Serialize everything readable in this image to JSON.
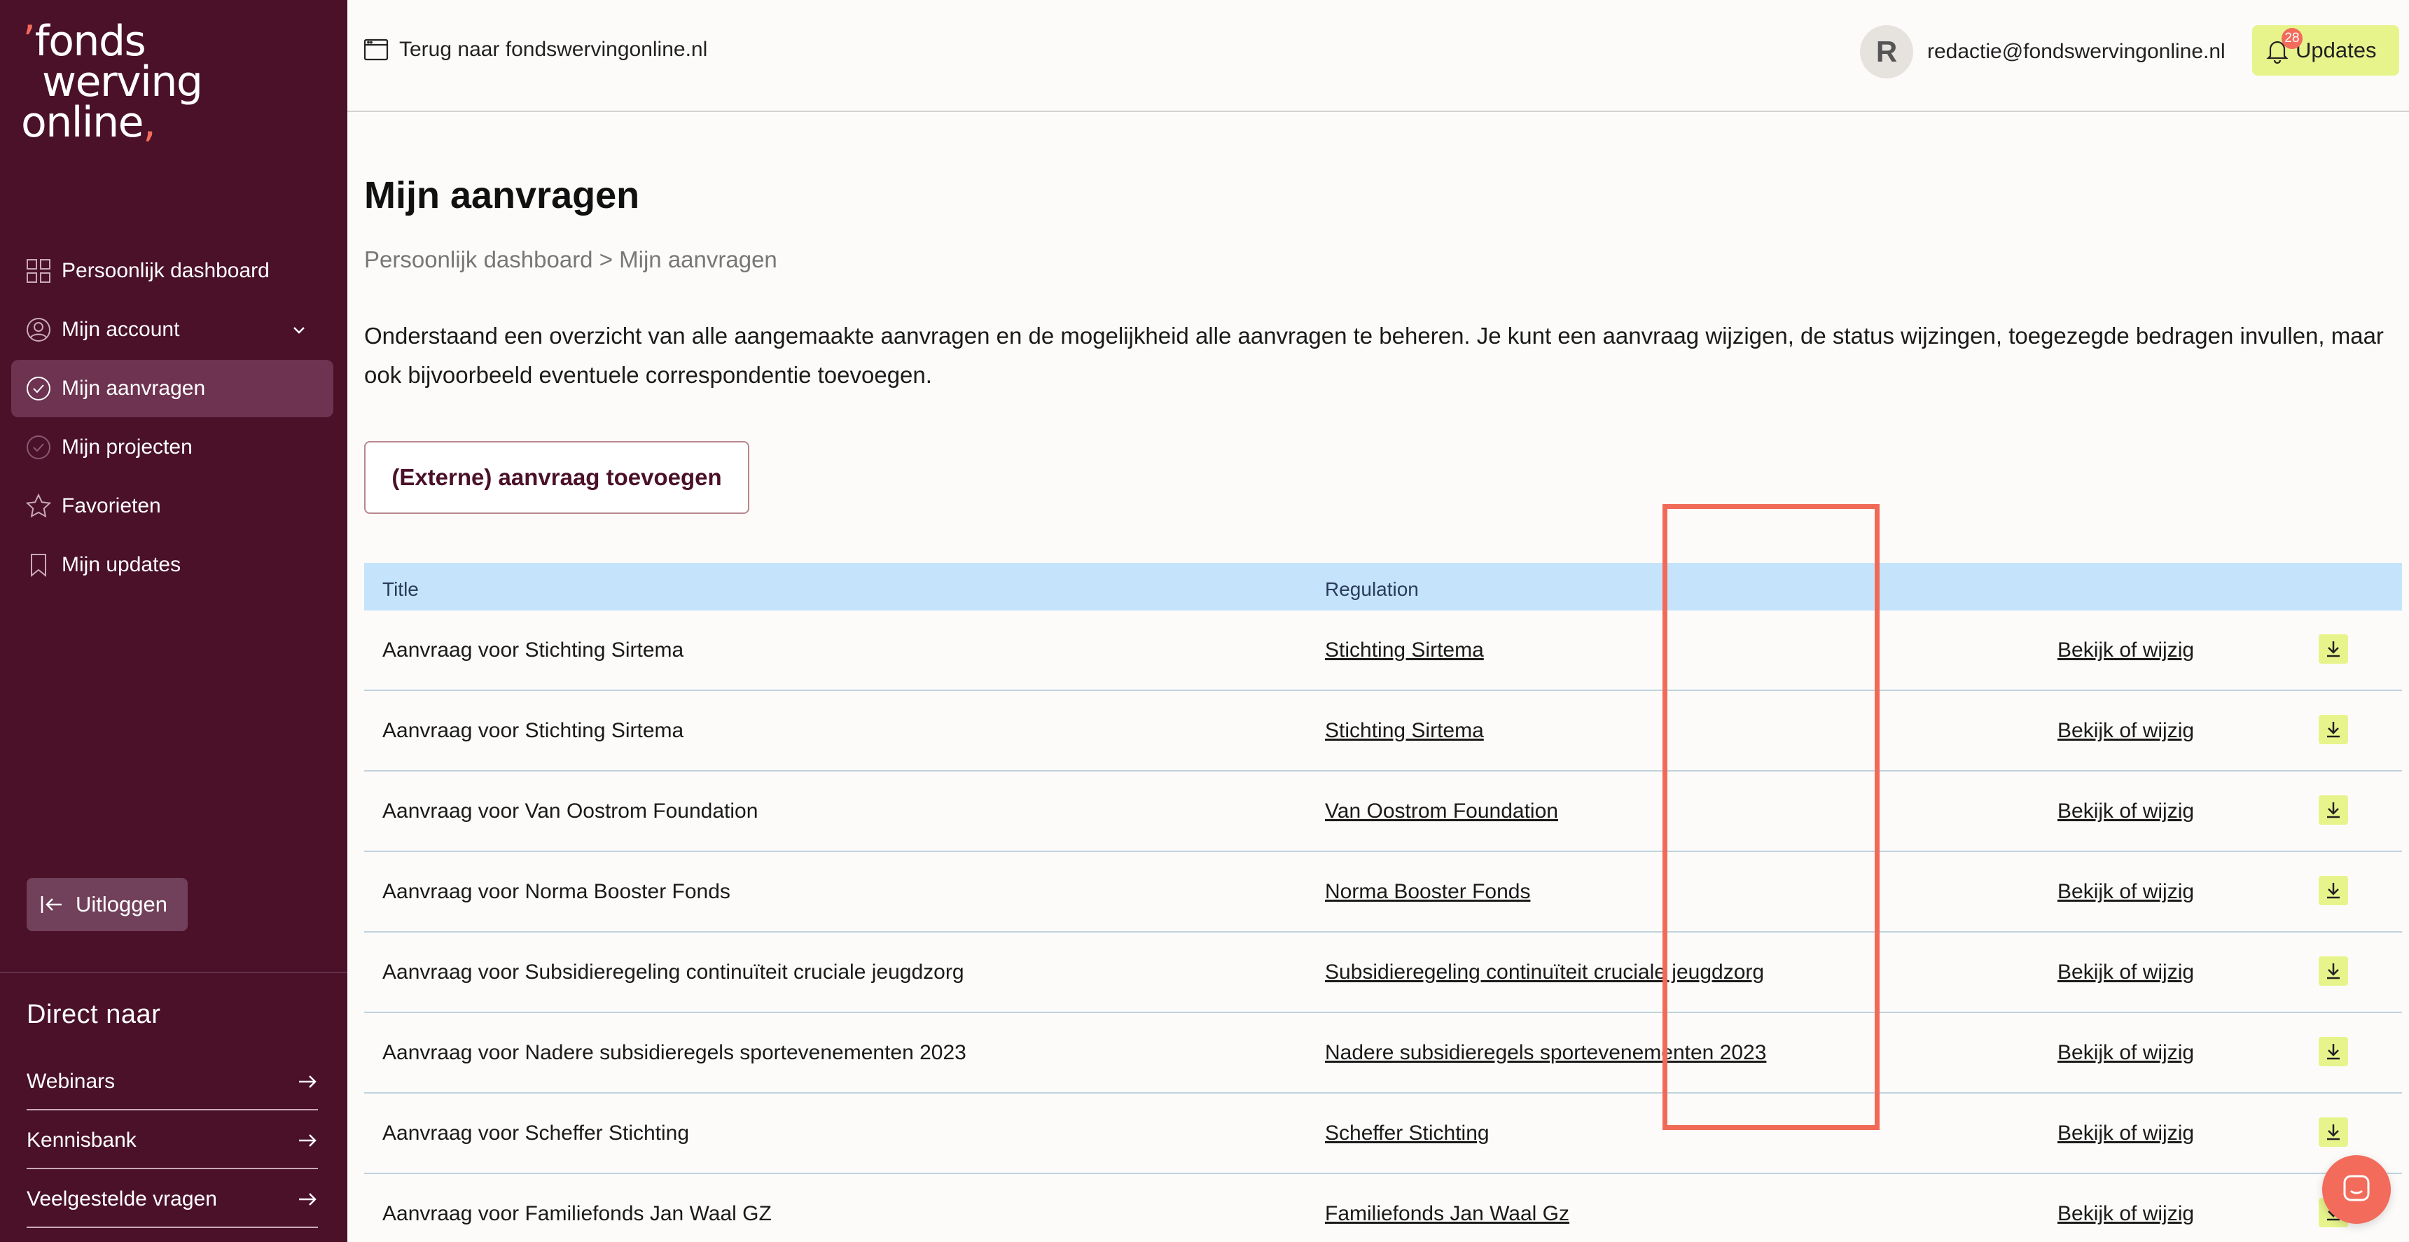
{
  "logo": {
    "line1": "fonds",
    "line2": "werving",
    "line3": "online"
  },
  "sidebar": {
    "items": [
      {
        "label": "Persoonlijk dashboard",
        "icon": "grid-icon"
      },
      {
        "label": "Mijn account",
        "icon": "user-icon"
      },
      {
        "label": "Mijn aanvragen",
        "icon": "check-circle-icon",
        "active": true
      },
      {
        "label": "Mijn projecten",
        "icon": "check-circle-icon"
      },
      {
        "label": "Favorieten",
        "icon": "star-icon"
      },
      {
        "label": "Mijn updates",
        "icon": "bookmark-icon"
      }
    ],
    "logout_label": "Uitloggen",
    "direct_title": "Direct naar",
    "direct_links": [
      "Webinars",
      "Kennisbank",
      "Veelgestelde vragen"
    ]
  },
  "topbar": {
    "back_label": "Terug naar fondswervingonline.nl",
    "avatar_initial": "R",
    "user_email": "redactie@fondswervingonline.nl",
    "updates_label": "Updates",
    "updates_count": "28"
  },
  "main": {
    "title": "Mijn aanvragen",
    "breadcrumb": "Persoonlijk dashboard > Mijn aanvragen",
    "intro": "Onderstaand een overzicht van alle aangemaakte aanvragen en de mogelijkheid alle aanvragen te beheren. Je kunt een aanvraag wijzigen, de status wijzingen, toegezegde bedragen invullen, maar ook bijvoorbeeld eventuele correspondentie toevoegen.",
    "add_button": "(Externe) aanvraag toevoegen"
  },
  "table": {
    "headers": {
      "title": "Title",
      "regulation": "Regulation"
    },
    "action_label": "Bekijk of wijzig",
    "rows": [
      {
        "title": "Aanvraag voor Stichting Sirtema",
        "regulation": "Stichting Sirtema"
      },
      {
        "title": "Aanvraag voor Stichting Sirtema",
        "regulation": "Stichting Sirtema"
      },
      {
        "title": "Aanvraag voor Van Oostrom Foundation",
        "regulation": "Van Oostrom Foundation"
      },
      {
        "title": "Aanvraag voor Norma Booster Fonds",
        "regulation": "Norma Booster Fonds"
      },
      {
        "title": "Aanvraag voor Subsidieregeling continuïteit cruciale jeugdzorg",
        "regulation": "Subsidieregeling continuïteit cruciale jeugdzorg"
      },
      {
        "title": "Aanvraag voor Nadere subsidieregels sportevenementen 2023",
        "regulation": "Nadere subsidieregels sportevenementen 2023"
      },
      {
        "title": "Aanvraag voor Scheffer Stichting",
        "regulation": "Scheffer Stichting"
      },
      {
        "title": "Aanvraag voor Familiefonds Jan Waal GZ",
        "regulation": "Familiefonds Jan Waal Gz"
      }
    ]
  },
  "colors": {
    "sidebar_bg": "#4a1128",
    "accent_coral": "#f26b5b",
    "accent_lime": "#e7f48c",
    "table_header_bg": "#c5e4fb"
  }
}
